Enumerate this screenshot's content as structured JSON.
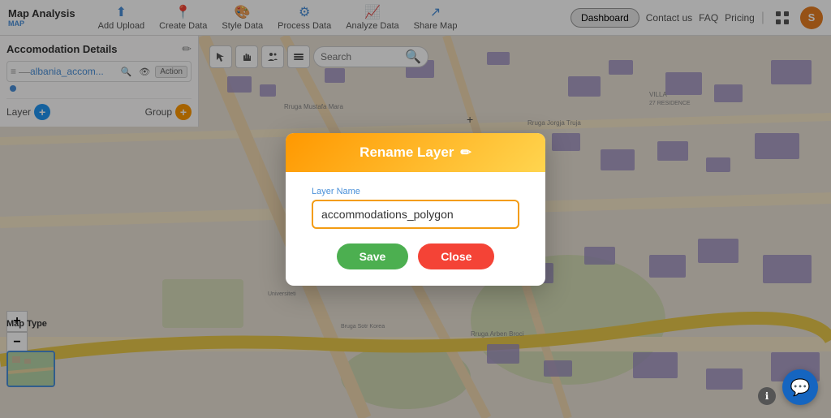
{
  "app": {
    "title": "Map Analysis",
    "subtitle": "MAP"
  },
  "nav": {
    "items": [
      {
        "id": "add-upload",
        "label": "Add Upload",
        "icon": "⬆"
      },
      {
        "id": "create-data",
        "label": "Create Data",
        "icon": "📍"
      },
      {
        "id": "style-data",
        "label": "Style Data",
        "icon": "🎨"
      },
      {
        "id": "process-data",
        "label": "Process Data",
        "icon": "⚙"
      },
      {
        "id": "analyze-data",
        "label": "Analyze Data",
        "icon": "📈"
      },
      {
        "id": "share-map",
        "label": "Share Map",
        "icon": "↗"
      }
    ],
    "right": {
      "dashboard": "Dashboard",
      "contact": "Contact us",
      "faq": "FAQ",
      "pricing": "Pricing",
      "avatar_initial": "S"
    }
  },
  "sidebar": {
    "title": "Accomodation Details",
    "edit_icon": "✏",
    "layer_name": "albania_accom...",
    "layer_color": "#4a90d9",
    "action_label": "Action",
    "layer_label": "Layer",
    "group_label": "Group"
  },
  "toolbar": {
    "search_placeholder": "Search"
  },
  "modal": {
    "title": "Rename Layer",
    "pencil_icon": "✏",
    "field_label": "Layer Name",
    "input_value": "accommodations_polygon",
    "save_label": "Save",
    "close_label": "Close"
  },
  "map": {
    "type_label": "Map Type",
    "zoom_in": "+",
    "zoom_out": "−"
  },
  "colors": {
    "accent_blue": "#2196f3",
    "accent_orange": "#ff9800",
    "save_green": "#4caf50",
    "close_red": "#f44336",
    "modal_border": "#f39c12",
    "layer_blue": "#4a90d9"
  }
}
